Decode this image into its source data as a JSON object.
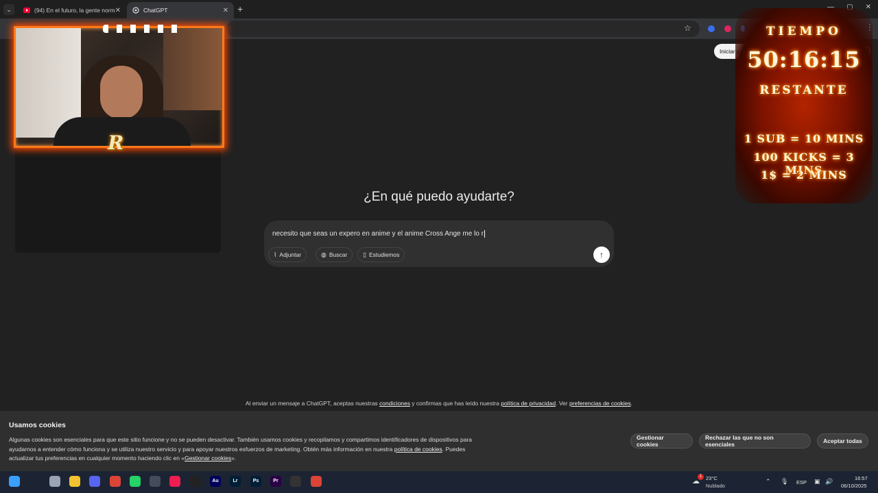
{
  "browser": {
    "tabs": [
      {
        "title": "(94) En el futuro, la gente norm",
        "icon": "youtube-icon",
        "active": false
      },
      {
        "title": "ChatGPT",
        "icon": "chatgpt-icon",
        "active": true
      }
    ],
    "new_tab_symbol": "+",
    "star_symbol": "☆",
    "menu_symbol": "⋮"
  },
  "chatgpt": {
    "login_label": "Iniciar s",
    "help_symbol": "?",
    "headline": "¿En qué puedo ayudarte?",
    "prompt_value": "necesito que seas un expero en anime y el anime Cross Ange me lo r",
    "chips": [
      {
        "label": "Adjuntar",
        "icon": "paperclip-icon",
        "glyph": "⌇"
      },
      {
        "label": "Buscar",
        "icon": "globe-icon",
        "glyph": "◍"
      },
      {
        "label": "Estudiemos",
        "icon": "book-icon",
        "glyph": "▯"
      }
    ],
    "send_symbol": "↑",
    "legal": {
      "prefix": "Al enviar un mensaje a ChatGPT, aceptas nuestras ",
      "terms": "condiciones",
      "middle": " y confirmas que has leído nuestra ",
      "privacy": "política de privacidad",
      "middle2": ". Ver ",
      "cookies": "preferencias de cookies",
      "suffix": "."
    }
  },
  "cookies": {
    "title": "Usamos cookies",
    "body_1": "Algunas cookies son esenciales para que este sitio funcione y no se pueden desactivar. También usamos cookies y recopilamos y compartimos identificadores de dispositivos para ayudarnos a entender cómo funciona y se utiliza nuestro servicio y para apoyar nuestros esfuerzos de marketing. Obtén más información en nuestra ",
    "policy_link": "política de cookies",
    "body_2": ". Puedes actualizar tus preferencias en cualquier momento haciendo clic en «",
    "manage_link": "Gestionar cookies",
    "body_3": "».",
    "buttons": {
      "manage": "Gestionar cookies",
      "reject": "Rechazar las que no son esenciales",
      "accept": "Aceptar todas"
    }
  },
  "overlay": {
    "timer_label": "TIEMPO",
    "timer_value": "50:16:15",
    "timer_sub": "RESTANTE",
    "rules": [
      "1 SUB = 10 MINS",
      "100 KICKS = 3 MINS",
      "1$ = 2 MINS"
    ],
    "logo_letter": "R"
  },
  "taskbar": {
    "apps": [
      {
        "icon": "windows-start-icon",
        "label": "",
        "color": "#3aa0ff"
      },
      {
        "icon": "search-icon",
        "label": "",
        "color": "#1c2433"
      },
      {
        "icon": "task-view-icon",
        "label": "",
        "color": "#9aa4b5"
      },
      {
        "icon": "file-explorer-icon",
        "label": "",
        "color": "#f2c230"
      },
      {
        "icon": "discord-icon",
        "label": "",
        "color": "#5865f2"
      },
      {
        "icon": "chrome-icon",
        "label": "",
        "color": "#db4437"
      },
      {
        "icon": "whatsapp-icon",
        "label": "",
        "color": "#25d366"
      },
      {
        "icon": "obs-icon",
        "label": "",
        "color": "#444c5c"
      },
      {
        "icon": "tiktok-icon",
        "label": "",
        "color": "#ee1d52"
      },
      {
        "icon": "capcut-icon",
        "label": "",
        "color": "#222"
      },
      {
        "icon": "audition-icon",
        "label": "Au",
        "color": "#00005b"
      },
      {
        "icon": "lightroom-icon",
        "label": "Lr",
        "color": "#001e36"
      },
      {
        "icon": "photoshop-icon",
        "label": "Ps",
        "color": "#001e36"
      },
      {
        "icon": "premiere-icon",
        "label": "Pr",
        "color": "#2a0046"
      },
      {
        "icon": "terminal-icon",
        "label": "",
        "color": "#333"
      },
      {
        "icon": "chrome-active-icon",
        "label": "",
        "color": "#db4437"
      }
    ],
    "weather_badge": "1",
    "weather_temp": "23°C",
    "weather_desc": "Nublado",
    "language": "ESP",
    "time": "16:57",
    "date": "06/10/2025"
  }
}
